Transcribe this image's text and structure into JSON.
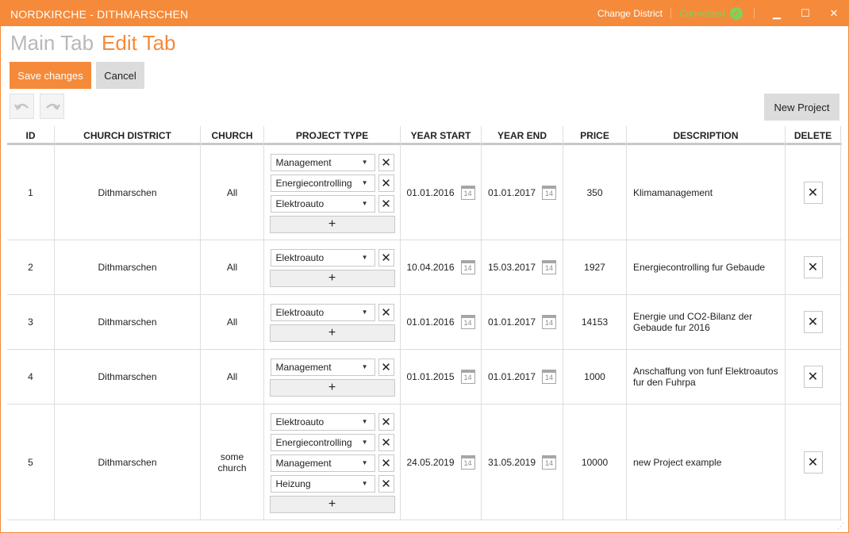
{
  "window": {
    "title": "NORDKIRCHE - DITHMARSCHEN",
    "change_district": "Change District",
    "connected": "Connected",
    "accent": "#f58a3a",
    "connected_color": "#7fd15a"
  },
  "tabs": {
    "main": "Main Tab",
    "edit": "Edit Tab"
  },
  "toolbar": {
    "save": "Save changes",
    "cancel": "Cancel",
    "new_project": "New Project"
  },
  "columns": [
    "ID",
    "CHURCH DISTRICT",
    "CHURCH",
    "PROJECT TYPE",
    "YEAR START",
    "YEAR END",
    "PRICE",
    "DESCRIPTION",
    "DELETE"
  ],
  "rows": [
    {
      "id": "1",
      "district": "Dithmarschen",
      "church": "All",
      "types": [
        "Management",
        "Energiecontrolling",
        "Elektroauto"
      ],
      "start": "01.01.2016",
      "end": "01.01.2017",
      "price": "350",
      "description": "Klimamanagement"
    },
    {
      "id": "2",
      "district": "Dithmarschen",
      "church": "All",
      "types": [
        "Elektroauto"
      ],
      "start": "10.04.2016",
      "end": "15.03.2017",
      "price": "1927",
      "description": "Energiecontrolling fur Gebaude"
    },
    {
      "id": "3",
      "district": "Dithmarschen",
      "church": "All",
      "types": [
        "Elektroauto"
      ],
      "start": "01.01.2016",
      "end": "01.01.2017",
      "price": "14153",
      "description": "Energie und CO2-Bilanz der Gebaude fur 2016"
    },
    {
      "id": "4",
      "district": "Dithmarschen",
      "church": "All",
      "types": [
        "Management"
      ],
      "start": "01.01.2015",
      "end": "01.01.2017",
      "price": "1000",
      "description": "Anschaffung von funf Elektroautos fur den Fuhrpa"
    },
    {
      "id": "5",
      "district": "Dithmarschen",
      "church": "some church",
      "types": [
        "Elektroauto",
        "Energiecontrolling",
        "Management",
        "Heizung"
      ],
      "start": "24.05.2019",
      "end": "31.05.2019",
      "price": "10000",
      "description": "new Project example"
    }
  ],
  "icons": {
    "calendar_day": "14",
    "delete": "✕",
    "add": "+",
    "dropdown": "▼",
    "undo": "undo-icon",
    "redo": "redo-icon"
  }
}
